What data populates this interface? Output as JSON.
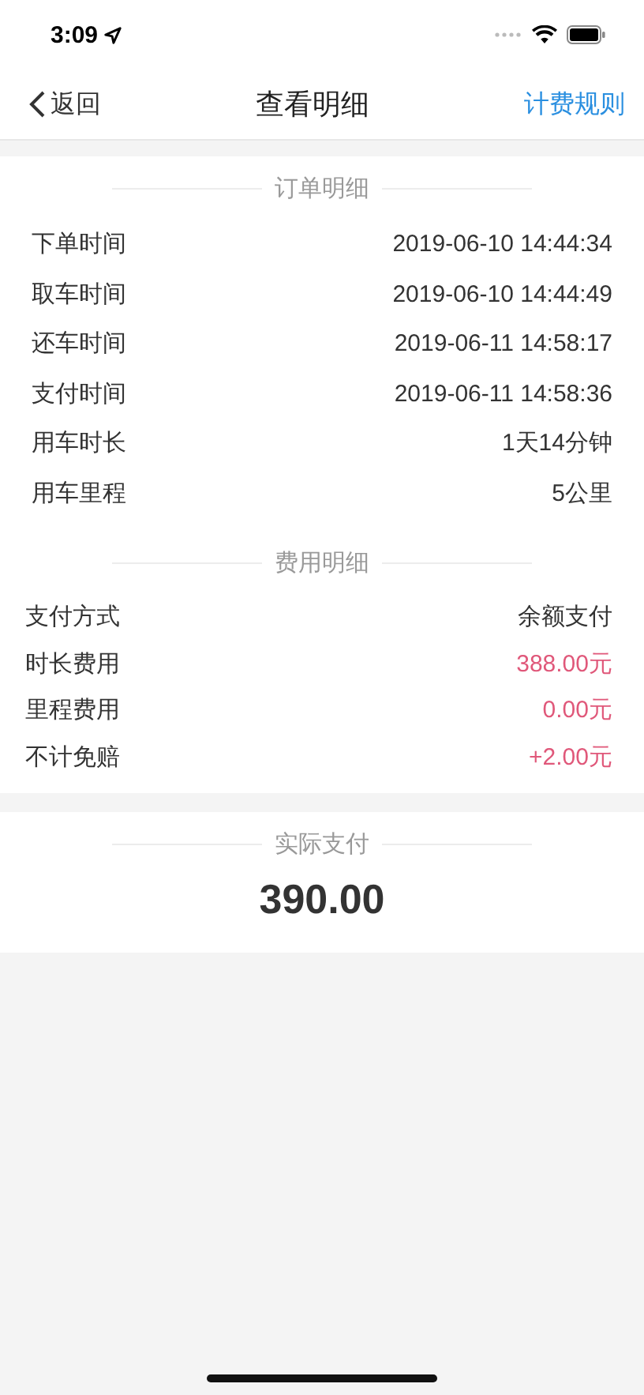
{
  "status_bar": {
    "time": "3:09"
  },
  "nav": {
    "back": "返回",
    "title": "查看明细",
    "action": "计费规则"
  },
  "order": {
    "heading": "订单明细",
    "rows": [
      {
        "label": "下单时间",
        "value": "2019-06-10 14:44:34"
      },
      {
        "label": "取车时间",
        "value": "2019-06-10 14:44:49"
      },
      {
        "label": "还车时间",
        "value": "2019-06-11 14:58:17"
      },
      {
        "label": "支付时间",
        "value": "2019-06-11 14:58:36"
      },
      {
        "label": "用车时长",
        "value": "1天14分钟"
      },
      {
        "label": "用车里程",
        "value": "5公里"
      }
    ]
  },
  "fees": {
    "heading": "费用明细",
    "rows": [
      {
        "label": "支付方式",
        "value": "余额支付",
        "kind": "plain"
      },
      {
        "label": "时长费用",
        "value": "388.00元",
        "kind": "amount"
      },
      {
        "label": "里程费用",
        "value": "0.00元",
        "kind": "amount"
      },
      {
        "label": "不计免赔",
        "value": "+2.00元",
        "kind": "amount"
      }
    ]
  },
  "total": {
    "heading": "实际支付",
    "amount": "390.00"
  }
}
